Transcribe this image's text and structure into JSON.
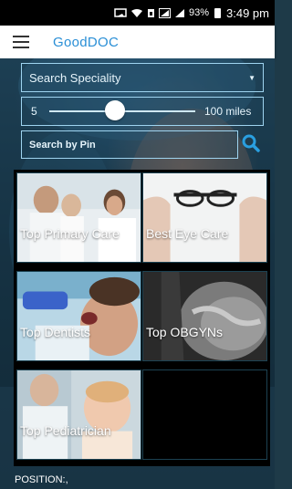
{
  "status_bar": {
    "battery": "93%",
    "time": "3:49 pm"
  },
  "app_bar": {
    "title": "GoodDOC",
    "menu_icon": "hamburger-menu-icon"
  },
  "search": {
    "speciality_placeholder": "Search Speciality",
    "radius_min": "5",
    "radius_max": "100 miles",
    "radius_value_fraction": 0.45,
    "pin_placeholder": "Search by Pin",
    "search_icon": "magnifier-icon"
  },
  "tiles": [
    {
      "label": "Top Primary Care"
    },
    {
      "label": "Best Eye Care"
    },
    {
      "label": "Top Dentists"
    },
    {
      "label": "Top OBGYNs"
    },
    {
      "label": "Top Pediatrician"
    },
    {
      "label": ""
    }
  ],
  "footer": {
    "position_label": "POSITION:,"
  },
  "colors": {
    "brand": "#2a8fd6",
    "field_border": "#9fd4f0"
  }
}
